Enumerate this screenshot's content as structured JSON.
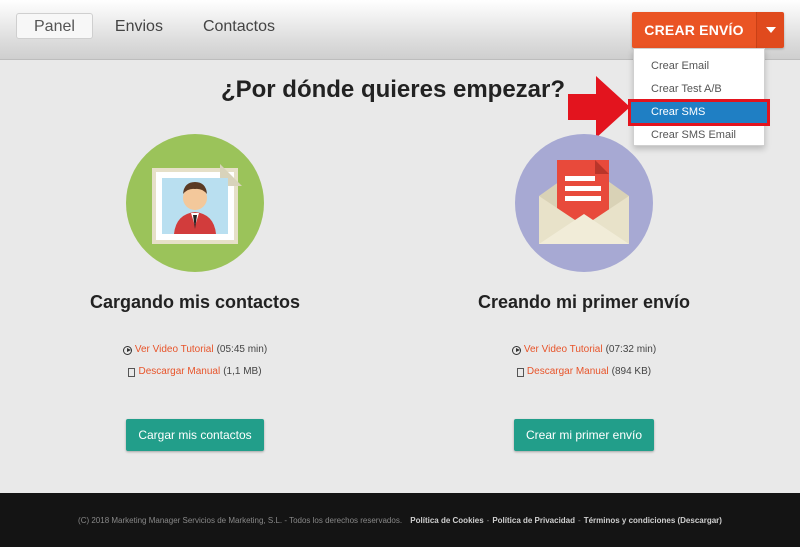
{
  "nav": {
    "items": [
      {
        "label": "Panel",
        "active": true
      },
      {
        "label": "Envios",
        "active": false
      },
      {
        "label": "Contactos",
        "active": false
      }
    ]
  },
  "create_button": {
    "label": "CREAR ENVÍO",
    "color": "#ea5424"
  },
  "dropdown": {
    "items": [
      {
        "label": "Crear Email"
      },
      {
        "label": "Crear Test A/B"
      },
      {
        "label": "Crear SMS",
        "highlighted": true
      },
      {
        "label": "Crear SMS Email"
      }
    ]
  },
  "main": {
    "title": "¿Por dónde quieres empezar?",
    "columns": [
      {
        "title": "Cargando mis contactos",
        "video_link": "Ver Video Tutorial",
        "video_duration": "(05:45 min)",
        "manual_link": "Descargar Manual",
        "manual_size": "(1,1 MB)",
        "button": "Cargar mis contactos"
      },
      {
        "title": "Creando mi primer envío",
        "video_link": "Ver Video Tutorial",
        "video_duration": "(07:32 min)",
        "manual_link": "Descargar Manual",
        "manual_size": "(894 KB)",
        "button": "Crear mi primer envío"
      }
    ]
  },
  "footer": {
    "copyright": "(C) 2018 Marketing Manager Servicios de Marketing, S.L. - Todos los derechos reservados.",
    "cookies": "Política de Cookies",
    "privacy": "Política de Privacidad",
    "terms": "Términos y condiciones (Descargar)",
    "sep": "-"
  },
  "colors": {
    "accent": "#ea5424",
    "teal": "#229e8a",
    "highlight": "#1f7fc4",
    "annotation_red": "#e3141e"
  }
}
